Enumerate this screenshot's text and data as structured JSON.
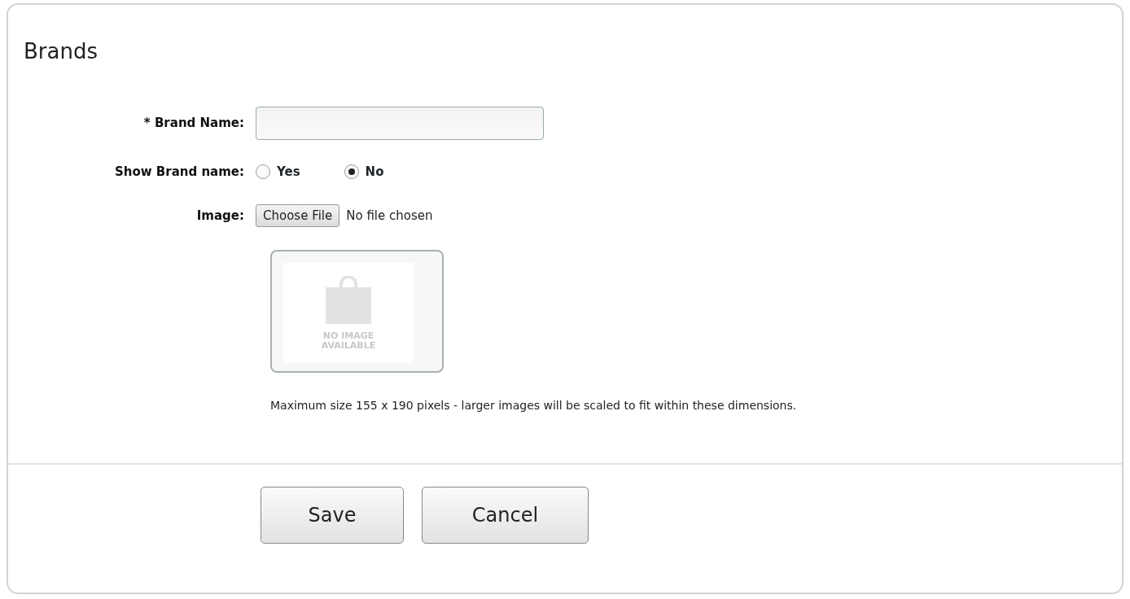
{
  "title": "Brands",
  "fields": [
    {
      "kind": "text",
      "label": "Brand Name:",
      "required_mark": "*"
    },
    {
      "kind": "radio",
      "label": "Show Brand name:",
      "options": [
        {
          "label": "Yes",
          "selected": false
        },
        {
          "label": "No",
          "selected": true
        }
      ]
    },
    {
      "kind": "file",
      "label": "Image:",
      "button": "Choose File",
      "status": "No file chosen"
    }
  ],
  "image_preview": {
    "caption_lines": [
      "NO IMAGE",
      "AVAILABLE"
    ]
  },
  "help_text": "Maximum size 155 x 190 pixels - larger images will be scaled to fit within these dimensions.",
  "buttons": [
    {
      "label": "Save"
    },
    {
      "label": "Cancel"
    }
  ]
}
